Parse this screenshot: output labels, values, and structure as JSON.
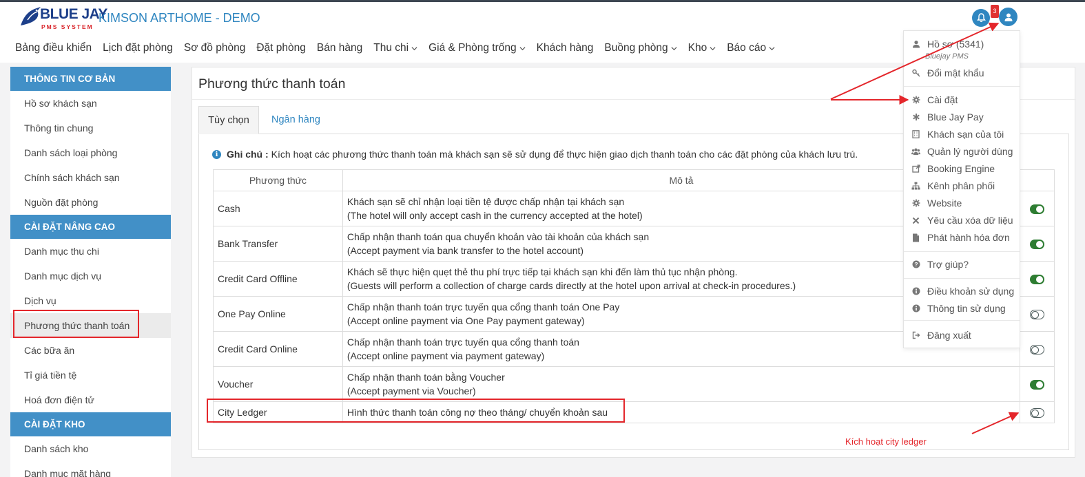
{
  "app": {
    "logo_text": "BLUE JAY",
    "logo_sub": "PMS SYSTEM",
    "hotel_name": "KIMSON ARTHOME - DEMO",
    "notification_count": "3",
    "colors": {
      "primary": "#2f86c0",
      "sidebar_header": "#4290c7",
      "toggle_on": "#2e7d32",
      "annotation": "#e4262b"
    }
  },
  "menu": [
    {
      "label": "Bảng điều khiển",
      "dropdown": false
    },
    {
      "label": "Lịch đặt phòng",
      "dropdown": false
    },
    {
      "label": "Sơ đồ phòng",
      "dropdown": false
    },
    {
      "label": "Đặt phòng",
      "dropdown": false
    },
    {
      "label": "Bán hàng",
      "dropdown": false
    },
    {
      "label": "Thu chi",
      "dropdown": true
    },
    {
      "label": "Giá & Phòng trống",
      "dropdown": true
    },
    {
      "label": "Khách hàng",
      "dropdown": false
    },
    {
      "label": "Buồng phòng",
      "dropdown": true
    },
    {
      "label": "Kho",
      "dropdown": true
    },
    {
      "label": "Báo cáo",
      "dropdown": true
    }
  ],
  "sidebar": {
    "sections": [
      {
        "title": "THÔNG TIN CƠ BẢN",
        "items": [
          "Hồ sơ khách sạn",
          "Thông tin chung",
          "Danh sách loại phòng",
          "Chính sách khách sạn",
          "Nguồn đặt phòng"
        ]
      },
      {
        "title": "CÀI ĐẶT NÂNG CAO",
        "items": [
          "Danh mục thu chi",
          "Danh mục dịch vụ",
          "Dịch vụ",
          "Phương thức thanh toán",
          "Các bữa ăn",
          "Tỉ giá tiền tệ",
          "Hoá đơn điện tử"
        ]
      },
      {
        "title": "CÀI ĐẶT KHO",
        "items": [
          "Danh sách kho",
          "Danh mục mặt hàng"
        ]
      }
    ],
    "active": "Phương thức thanh toán"
  },
  "page": {
    "title": "Phương thức thanh toán",
    "tabs": [
      "Tùy chọn",
      "Ngân hàng"
    ],
    "note_label": "Ghi chú :",
    "note_text": "Kích hoạt các phương thức thanh toán mà khách sạn sẽ sử dụng để thực hiện giao dịch thanh toán cho các đặt phòng của khách lưu trú.",
    "table": {
      "headers": [
        "Phương thức",
        "Mô tả"
      ],
      "rows": [
        {
          "method": "Cash",
          "desc_vi": "Khách sạn sẽ chỉ nhận loại tiền tệ được chấp nhận tại khách sạn",
          "desc_en": "(The hotel will only accept cash in the currency accepted at the hotel)",
          "enabled": true
        },
        {
          "method": "Bank Transfer",
          "desc_vi": "Chấp nhận thanh toán qua chuyển khoản vào tài khoản của khách sạn",
          "desc_en": "(Accept payment via bank transfer to the hotel account)",
          "enabled": true
        },
        {
          "method": "Credit Card Offline",
          "desc_vi": "Khách sẽ thực hiện quẹt thẻ thu phí trực tiếp tại khách sạn khi đến làm thủ tục nhận phòng.",
          "desc_en": "(Guests will perform a collection of charge cards directly at the hotel upon arrival at check-in procedures.)",
          "enabled": true
        },
        {
          "method": "One Pay Online",
          "desc_vi": "Chấp nhận thanh toán trực tuyến qua cổng thanh toán One Pay",
          "desc_en": "(Accept online payment via One Pay payment gateway)",
          "enabled": false
        },
        {
          "method": "Credit Card Online",
          "desc_vi": "Chấp nhận thanh toán trực tuyến qua cổng thanh toán",
          "desc_en": "(Accept online payment via payment gateway)",
          "enabled": false
        },
        {
          "method": "Voucher",
          "desc_vi": "Chấp nhận thanh toán bằng Voucher",
          "desc_en": "(Accept payment via Voucher)",
          "enabled": true
        },
        {
          "method": "City Ledger",
          "desc_vi": "Hình thức thanh toán công nợ theo tháng/ chuyển khoản sau",
          "desc_en": "",
          "enabled": false
        }
      ]
    }
  },
  "user_menu": {
    "profile": "Hồ sơ  (5341)",
    "profile_sub": "Bluejay PMS",
    "items": [
      {
        "label": "Đổi mật khẩu",
        "icon": "key-icon"
      },
      {
        "label": "Cài đặt",
        "icon": "gear-icon"
      },
      {
        "label": "Blue Jay Pay",
        "icon": "asterisk-icon"
      },
      {
        "label": "Khách sạn của tôi",
        "icon": "building-icon"
      },
      {
        "label": "Quản lý người dùng",
        "icon": "users-icon"
      },
      {
        "label": "Booking Engine",
        "icon": "external-link-icon"
      },
      {
        "label": "Kênh phân phối",
        "icon": "sitemap-icon"
      },
      {
        "label": "Website",
        "icon": "gear-icon"
      },
      {
        "label": "Yêu cầu xóa dữ liệu",
        "icon": "close-icon"
      },
      {
        "label": "Phát hành hóa đơn",
        "icon": "file-icon"
      },
      {
        "label": "Trợ giúp?",
        "icon": "question-icon"
      },
      {
        "label": "Điều khoản sử dụng",
        "icon": "info-icon"
      },
      {
        "label": "Thông tin sử dụng",
        "icon": "info-icon"
      },
      {
        "label": "Đăng xuất",
        "icon": "sign-out-icon"
      }
    ]
  },
  "annotation": {
    "label": "Kích hoạt city ledger"
  }
}
